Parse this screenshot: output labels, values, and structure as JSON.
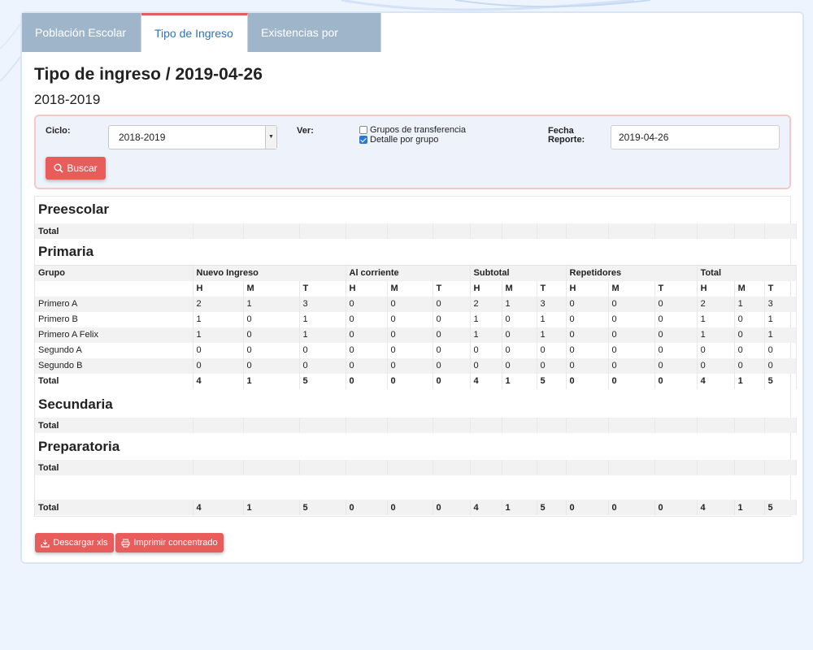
{
  "tabs": [
    "Población Escolar",
    "Tipo de Ingreso",
    "Existencias por Edad"
  ],
  "page_title": "Tipo de ingreso / 2019-04-26",
  "subtitle": "2018-2019",
  "filters": {
    "ciclo_label": "Ciclo:",
    "ciclo_value": "2018-2019",
    "ver_label": "Ver:",
    "opt_transfer": "Grupos de transferencia",
    "opt_detalle": "Detalle por grupo",
    "fecha_label_1": "Fecha",
    "fecha_label_2": "Reporte:",
    "fecha_value": "2019-04-26",
    "search_button": "Buscar"
  },
  "sections": {
    "preescolar": "Preescolar",
    "primaria": "Primaria",
    "secundaria": "Secundaria",
    "preparatoria": "Preparatoria"
  },
  "total_label": "Total",
  "headers": {
    "grupo": "Grupo",
    "groups": [
      "Nuevo Ingreso",
      "Al corriente",
      "Subtotal",
      "Repetidores",
      "Total"
    ],
    "sub": [
      "H",
      "M",
      "T",
      "H",
      "M",
      "T",
      "H",
      "M",
      "T",
      "H",
      "M",
      "T",
      "H",
      "M",
      "T"
    ]
  },
  "primaria_rows": [
    {
      "name": "Primero A",
      "vals": [
        "2",
        "1",
        "3",
        "0",
        "0",
        "0",
        "2",
        "1",
        "3",
        "0",
        "0",
        "0",
        "2",
        "1",
        "3"
      ]
    },
    {
      "name": "Primero B",
      "vals": [
        "1",
        "0",
        "1",
        "0",
        "0",
        "0",
        "1",
        "0",
        "1",
        "0",
        "0",
        "0",
        "1",
        "0",
        "1"
      ]
    },
    {
      "name": "Primero A Felix",
      "vals": [
        "1",
        "0",
        "1",
        "0",
        "0",
        "0",
        "1",
        "0",
        "1",
        "0",
        "0",
        "0",
        "1",
        "0",
        "1"
      ]
    },
    {
      "name": "Segundo A",
      "vals": [
        "0",
        "0",
        "0",
        "0",
        "0",
        "0",
        "0",
        "0",
        "0",
        "0",
        "0",
        "0",
        "0",
        "0",
        "0"
      ]
    },
    {
      "name": "Segundo B",
      "vals": [
        "0",
        "0",
        "0",
        "0",
        "0",
        "0",
        "0",
        "0",
        "0",
        "0",
        "0",
        "0",
        "0",
        "0",
        "0"
      ]
    }
  ],
  "primaria_total": [
    "4",
    "1",
    "5",
    "0",
    "0",
    "0",
    "4",
    "1",
    "5",
    "0",
    "0",
    "0",
    "4",
    "1",
    "5"
  ],
  "grand_total": [
    "4",
    "1",
    "5",
    "0",
    "0",
    "0",
    "4",
    "1",
    "5",
    "0",
    "0",
    "0",
    "4",
    "1",
    "5"
  ],
  "actions": {
    "download": "Descargar xls",
    "print": "Imprimir concentrado"
  },
  "colors": {
    "accent_red": "#e85c5c",
    "tab_inactive": "#9fb5ca",
    "tab_active_text": "#2b74c2"
  }
}
